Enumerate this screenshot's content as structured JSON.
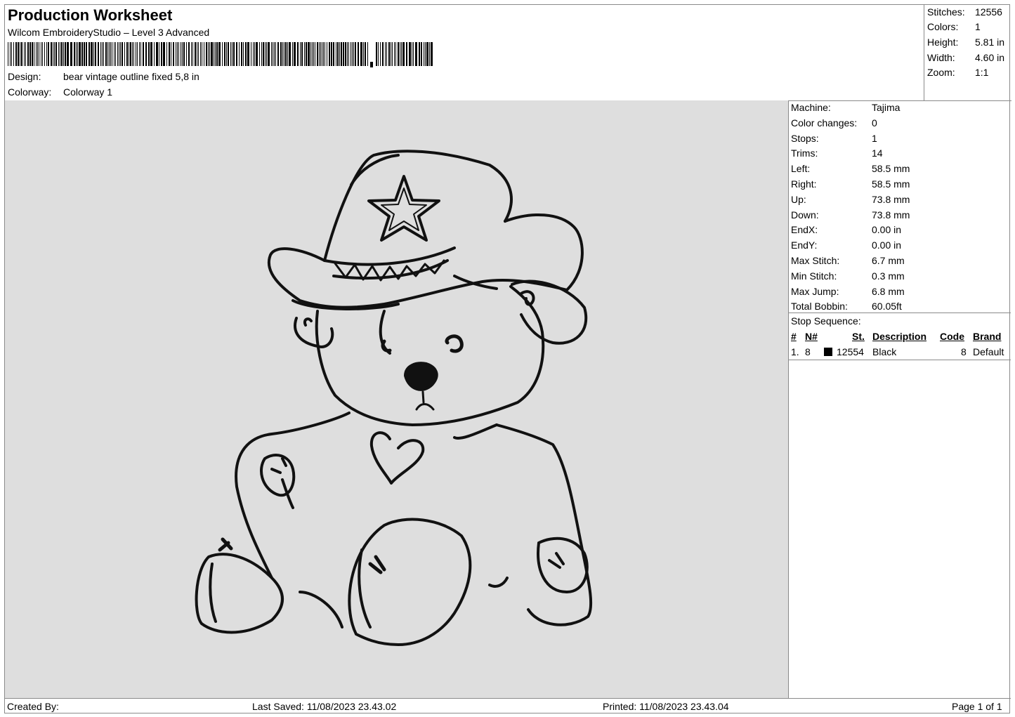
{
  "header": {
    "title": "Production Worksheet",
    "software": "Wilcom EmbroideryStudio – Level 3 Advanced",
    "design_label": "Design:",
    "design_value": "bear vintage  outline fixed 5,8 in",
    "colorway_label": "Colorway:",
    "colorway_value": "Colorway 1"
  },
  "summary": {
    "stitches_label": "Stitches:",
    "stitches": "12556",
    "colors_label": "Colors:",
    "colors": "1",
    "height_label": "Height:",
    "height": "5.81 in",
    "width_label": "Width:",
    "width": "4.60 in",
    "zoom_label": "Zoom:",
    "zoom": "1:1"
  },
  "machine": [
    {
      "label": "Machine:",
      "value": "Tajima"
    },
    {
      "label": "Color changes:",
      "value": "0"
    },
    {
      "label": "Stops:",
      "value": "1"
    },
    {
      "label": "Trims:",
      "value": "14"
    },
    {
      "label": "Left:",
      "value": "58.5 mm"
    },
    {
      "label": "Right:",
      "value": "58.5 mm"
    },
    {
      "label": "Up:",
      "value": "73.8 mm"
    },
    {
      "label": "Down:",
      "value": "73.8 mm"
    },
    {
      "label": "EndX:",
      "value": "0.00 in"
    },
    {
      "label": "EndY:",
      "value": "0.00 in"
    },
    {
      "label": "Max Stitch:",
      "value": "6.7 mm"
    },
    {
      "label": "Min Stitch:",
      "value": "0.3 mm"
    },
    {
      "label": "Max Jump:",
      "value": "6.8 mm"
    },
    {
      "label": "Total Bobbin:",
      "value": "60.05ft"
    }
  ],
  "stop_sequence": {
    "title": "Stop Sequence:",
    "headers": {
      "num": "#",
      "needle": "N#",
      "stitches": "St.",
      "description": "Description",
      "code": "Code",
      "brand": "Brand"
    },
    "rows": [
      {
        "num": "1.",
        "needle": "8",
        "color": "#000000",
        "stitches": "12554",
        "description": "Black",
        "code": "8",
        "brand": "Default"
      }
    ]
  },
  "footer": {
    "created_by": "Created By:",
    "last_saved": "Last Saved: 11/08/2023 23.43.02",
    "printed": "Printed: 11/08/2023 23.43.04",
    "page": "Page 1 of 1"
  },
  "colors": {
    "design_bg": "#dedede",
    "thread": "#111111",
    "border": "#8a8a8a"
  }
}
